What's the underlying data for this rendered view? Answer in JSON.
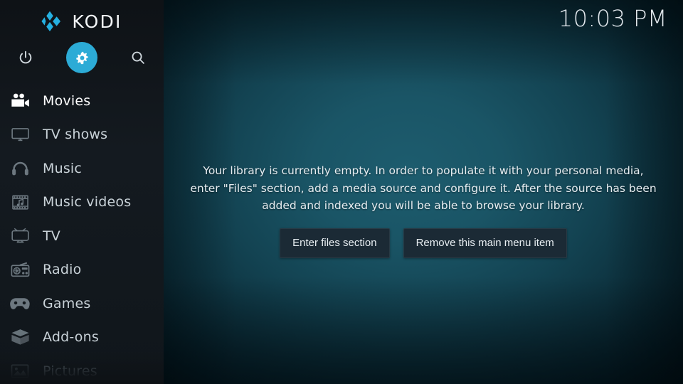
{
  "app": {
    "name": "KODI",
    "logo_icon": "kodi-logo-icon",
    "accent_color": "#2cabd6",
    "sidebar_bg": "#101619",
    "content_bg": "#1a5566"
  },
  "header": {
    "clock": "10:03 PM"
  },
  "top_icons": [
    {
      "name": "power-icon",
      "label": "Power",
      "selected": false
    },
    {
      "name": "gear-icon",
      "label": "Settings",
      "selected": true
    },
    {
      "name": "search-icon",
      "label": "Search",
      "selected": false
    }
  ],
  "sidebar": {
    "items": [
      {
        "label": "Movies",
        "icon": "movie-camera-icon",
        "state": "selected"
      },
      {
        "label": "TV shows",
        "icon": "tv-monitor-icon",
        "state": "normal"
      },
      {
        "label": "Music",
        "icon": "headphones-icon",
        "state": "normal"
      },
      {
        "label": "Music videos",
        "icon": "film-note-icon",
        "state": "normal"
      },
      {
        "label": "TV",
        "icon": "television-icon",
        "state": "normal"
      },
      {
        "label": "Radio",
        "icon": "radio-icon",
        "state": "normal"
      },
      {
        "label": "Games",
        "icon": "gamepad-icon",
        "state": "normal"
      },
      {
        "label": "Add-ons",
        "icon": "open-box-icon",
        "state": "normal"
      },
      {
        "label": "Pictures",
        "icon": "picture-icon",
        "state": "faded"
      }
    ]
  },
  "main": {
    "empty_message": "Your library is currently empty. In order to populate it with your personal media, enter \"Files\" section, add a media source and configure it. After the source has been added and indexed you will be able to browse your library.",
    "buttons": {
      "enter_files": "Enter files section",
      "remove_item": "Remove this main menu item"
    }
  }
}
